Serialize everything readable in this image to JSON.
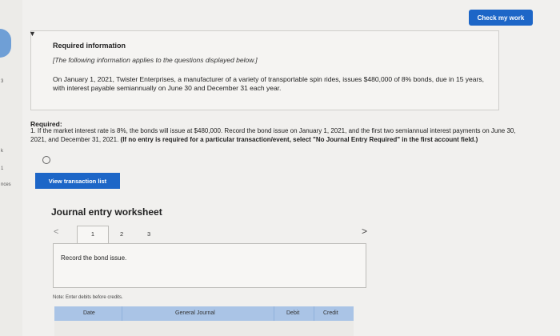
{
  "left_sidebar": {
    "labels": [
      "3",
      "k",
      "1",
      "nces"
    ]
  },
  "header": {
    "check_button_label": "Check my work"
  },
  "info": {
    "title": "Required information",
    "note": "[The following information applies to the questions displayed below.]",
    "body": "On January 1, 2021, Twister Enterprises, a manufacturer of a variety of transportable spin rides, issues $480,000 of 8% bonds, due in 15 years, with interest payable semiannually on June 30 and December 31 each year."
  },
  "required": {
    "title": "Required:",
    "text": "1. If the market interest rate is 8%, the bonds will issue at $480,000. Record the bond issue on January 1, 2021, and the first two semiannual interest payments on June 30, 2021, and December 31, 2021.",
    "bold_text": "(If no entry is required for a particular transaction/event, select \"No Journal Entry Required\" in the first account field.)"
  },
  "buttons": {
    "view_transaction_list": "View transaction list"
  },
  "worksheet": {
    "title": "Journal entry worksheet",
    "tabs": [
      "1",
      "2",
      "3"
    ],
    "active_tab": "1",
    "description": "Record the bond issue.",
    "note": "Note: Enter debits before credits.",
    "columns": [
      "Date",
      "General Journal",
      "Debit",
      "Credit"
    ]
  },
  "colors": {
    "accent_blue": "#1d66c7",
    "table_header": "#aac4e6"
  }
}
